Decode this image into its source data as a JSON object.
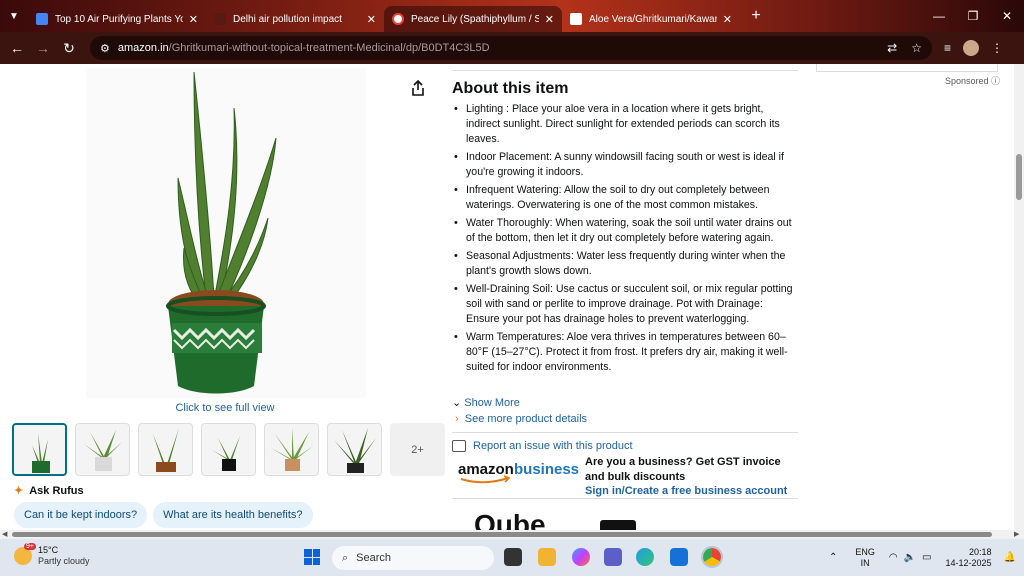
{
  "browser": {
    "tabs": [
      {
        "title": "Top 10 Air Purifying Plants You",
        "color": "#4285f4",
        "active": false
      },
      {
        "title": "Delhi air pollution impact",
        "color": "#222222",
        "active": false
      },
      {
        "title": "Peace Lily (Spathiphyllum / Spa",
        "color": "#ea4335",
        "active": true
      },
      {
        "title": "Aloe Vera/Ghritkumari/Kawar G",
        "color": "#222222",
        "active": false
      }
    ],
    "url_host": "amazon.in",
    "url_path": "/Ghritkumari-without-topical-treatment-Medicinal/dp/B0DT4C3L5D"
  },
  "product": {
    "full_view_label": "Click to see full view",
    "more_thumbs_label": "2+",
    "rufus_label": "Ask Rufus",
    "chips": [
      "Can it be kept indoors?",
      "What are its health benefits?"
    ]
  },
  "about": {
    "title": "About this item",
    "bullets": [
      "Lighting : Place your aloe vera in a location where it gets bright, indirect sunlight. Direct sunlight for extended periods can scorch its leaves.",
      "Indoor Placement: A sunny windowsill facing south or west is ideal if you're growing it indoors.",
      "Infrequent Watering: Allow the soil to dry out completely between waterings. Overwatering is one of the most common mistakes.",
      "Water Thoroughly: When watering, soak the soil until water drains out of the bottom, then let it dry out completely before watering again.",
      "Seasonal Adjustments: Water less frequently during winter when the plant's growth slows down.",
      "Well-Draining Soil: Use cactus or succulent soil, or mix regular potting soil with sand or perlite to improve drainage. Pot with Drainage: Ensure your pot has drainage holes to prevent waterlogging.",
      "Warm Temperatures: Aloe vera thrives in temperatures between 60–80°F (15–27°C). Protect it from frost. It prefers dry air, making it well-suited for indoor environments."
    ],
    "show_more": "Show More",
    "see_more_details": "See more product details",
    "report_issue": "Report an issue with this product"
  },
  "business": {
    "logo_word1": "amazon",
    "logo_word2": "business",
    "pitch": "Are you a business? Get GST invoice and bulk discounts",
    "link": "Sign in/Create a free business account"
  },
  "ad": {
    "sponsored_label": "Sponsored",
    "partial_text": "Qube"
  },
  "taskbar": {
    "weather_temp": "15°C",
    "weather_cond": "Partly cloudy",
    "weather_badge": "9+",
    "search_label": "Search",
    "lang_1": "ENG",
    "lang_2": "IN",
    "time": "20:18",
    "date": "14-12-2025"
  }
}
